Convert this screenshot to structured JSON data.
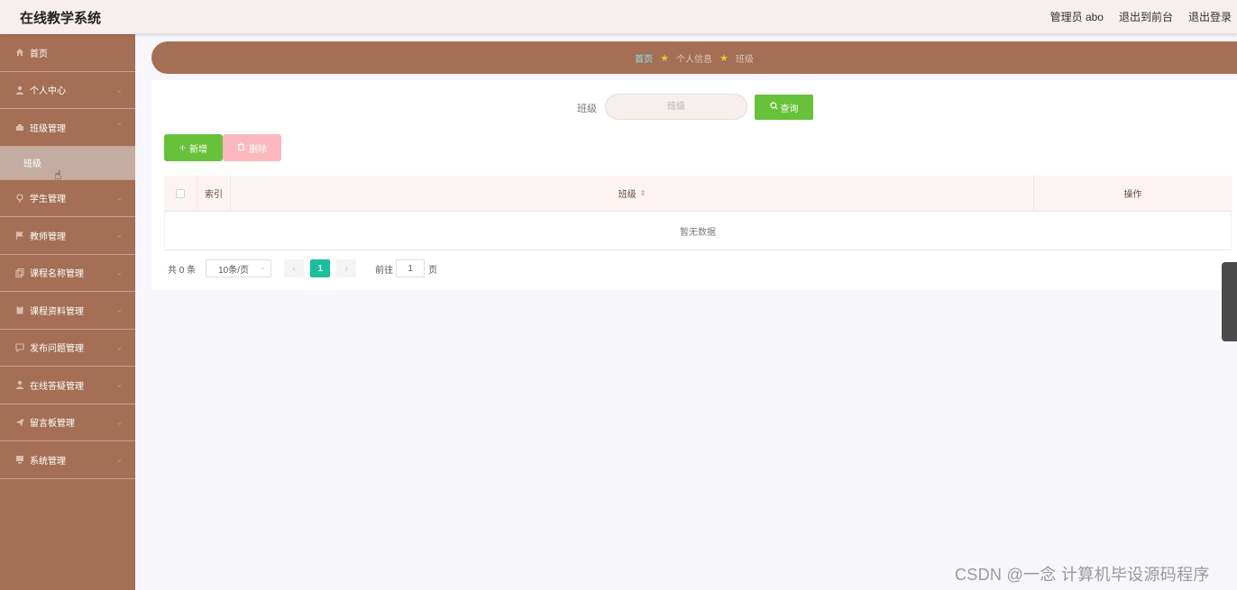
{
  "header": {
    "title": "在线教学系统",
    "user_label": "管理员 abo",
    "to_front_label": "退出到前台",
    "logout_label": "退出登录"
  },
  "sidebar": {
    "items": [
      {
        "label": "首页",
        "icon": "home-icon",
        "expandable": false
      },
      {
        "label": "个人中心",
        "icon": "user-icon",
        "expandable": true
      },
      {
        "label": "班级管理",
        "icon": "class-icon",
        "expandable": true,
        "expanded": true
      },
      {
        "label": "学生管理",
        "icon": "student-icon",
        "expandable": true
      },
      {
        "label": "教师管理",
        "icon": "flag-icon",
        "expandable": true
      },
      {
        "label": "课程名称管理",
        "icon": "copy-icon",
        "expandable": true
      },
      {
        "label": "课程资料管理",
        "icon": "clipboard-icon",
        "expandable": true
      },
      {
        "label": "发布问题管理",
        "icon": "chat-icon",
        "expandable": true
      },
      {
        "label": "在线答疑管理",
        "icon": "user-icon",
        "expandable": true
      },
      {
        "label": "留言板管理",
        "icon": "send-icon",
        "expandable": true
      },
      {
        "label": "系统管理",
        "icon": "monitor-icon",
        "expandable": true
      }
    ],
    "submenu": {
      "label": "班级",
      "active": true
    }
  },
  "breadcrumb": {
    "home": "首页",
    "level1": "个人信息",
    "level2": "班级"
  },
  "search": {
    "label": "班级",
    "placeholder": "班级",
    "button_label": "查询"
  },
  "actions": {
    "add_label": "新增",
    "delete_label": "删除"
  },
  "table": {
    "columns": [
      "索引",
      "班级",
      "操作"
    ],
    "empty_text": "暂无数据"
  },
  "pagination": {
    "total_text": "共 0 条",
    "page_size": "10条/页",
    "current_page": "1",
    "goto_prefix": "前往",
    "goto_value": "1",
    "goto_suffix": "页"
  },
  "watermark": "CSDN @一念 计算机毕设源码程序",
  "colors": {
    "sidebar_bg": "#a46f55",
    "header_bg": "#f7eeee",
    "primary_green": "#67c23a",
    "delete_pink": "#fbb9bd",
    "page_active": "#19be9b"
  }
}
